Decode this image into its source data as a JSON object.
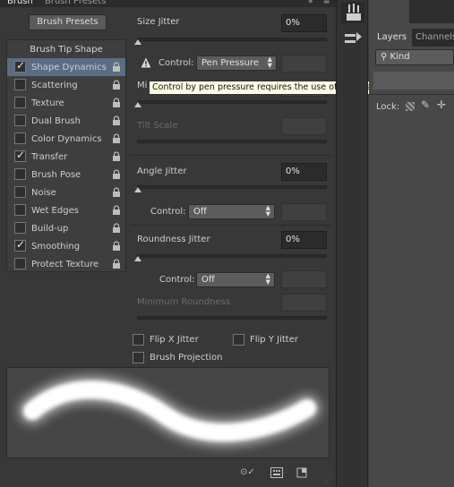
{
  "tabs": [
    "Brush",
    "Brush Presets"
  ],
  "brush_presets_button": "Brush Presets",
  "brush_tip_shape": "Brush Tip Shape",
  "items": [
    {
      "label": "Shape Dynamics",
      "checked": true,
      "selected": true
    },
    {
      "label": "Scattering",
      "checked": false
    },
    {
      "label": "Texture",
      "checked": false
    },
    {
      "label": "Dual Brush",
      "checked": false
    },
    {
      "label": "Color Dynamics",
      "checked": false
    },
    {
      "label": "Transfer",
      "checked": true
    },
    {
      "label": "Brush Pose",
      "checked": false
    },
    {
      "label": "Noise",
      "checked": false
    },
    {
      "label": "Wet Edges",
      "checked": false
    },
    {
      "label": "Build-up",
      "checked": false
    },
    {
      "label": "Smoothing",
      "checked": true
    },
    {
      "label": "Protect Texture",
      "checked": false
    }
  ],
  "size_jitter": {
    "label": "Size Jitter",
    "value": "0%",
    "slider_level": 0
  },
  "size_control": {
    "label": "Control:",
    "value": "Pen Pressure",
    "warning_icon": "warning-icon"
  },
  "minimum_diameter": {
    "label": "Mi"
  },
  "tooltip": "Control by pen pressure requires the use of a pressure sensitive tablet",
  "tilt_scale": {
    "label": "Tilt Scale"
  },
  "angle_jitter": {
    "label": "Angle Jitter",
    "value": "0%",
    "slider_level": 0
  },
  "angle_control": {
    "label": "Control:",
    "value": "Off"
  },
  "roundness_jitter": {
    "label": "Roundness Jitter",
    "value": "0%",
    "slider_level": 0
  },
  "roundness_control": {
    "label": "Control:",
    "value": "Off"
  },
  "minimum_roundness": {
    "label": "Minimum Roundness"
  },
  "flip_x": {
    "label": "Flip X Jitter",
    "checked": false
  },
  "flip_y": {
    "label": "Flip Y Jitter",
    "checked": false
  },
  "brush_projection": {
    "label": "Brush Projection",
    "checked": false
  },
  "right_panel": {
    "tabs": [
      "Layers",
      "Channels"
    ],
    "kind_label": "Kind",
    "lock_label": "Lock:"
  },
  "colors": {
    "selected_row": "#5b6d83",
    "panel_bg": "#383838",
    "tooltip_bg": "#ffffe1"
  }
}
